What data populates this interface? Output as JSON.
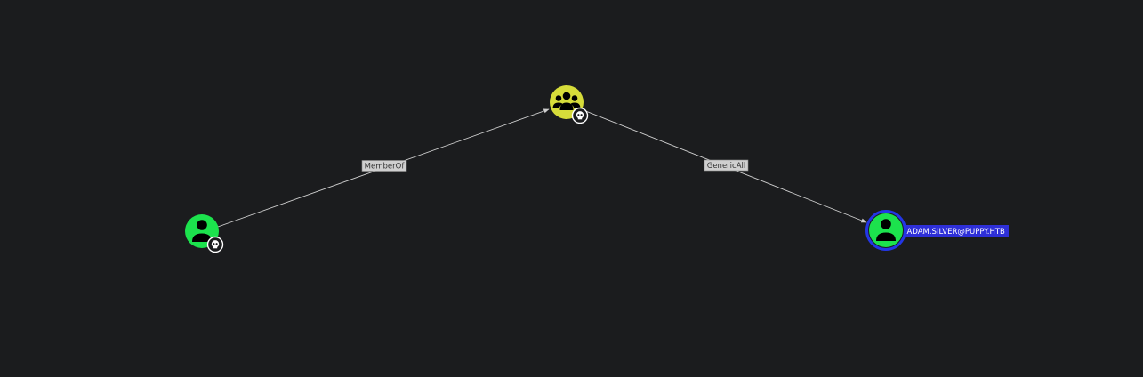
{
  "graph": {
    "nodes": [
      {
        "id": "user-owned",
        "kind": "user",
        "color": "#1ce24d",
        "owned": true,
        "selected": false,
        "label": ""
      },
      {
        "id": "group-owned",
        "kind": "group",
        "color": "#d6dc3a",
        "owned": true,
        "selected": false,
        "label": ""
      },
      {
        "id": "user-target",
        "kind": "user",
        "color": "#1ce24d",
        "owned": false,
        "selected": true,
        "label": "ADAM.SILVER@PUPPY.HTB"
      }
    ],
    "edges": [
      {
        "from": "user-owned",
        "to": "group-owned",
        "label": "MemberOf"
      },
      {
        "from": "group-owned",
        "to": "user-target",
        "label": "GenericAll"
      }
    ],
    "colors": {
      "background": "#1b1c1e",
      "edge": "#cfcfcf",
      "selection_ring": "#2336e6",
      "selected_label_bg": "#2e2fd8",
      "owned_badge_bg": "#ffffff"
    },
    "icons": {
      "user": "user-icon",
      "group": "group-icon",
      "owned": "skull-icon"
    }
  }
}
